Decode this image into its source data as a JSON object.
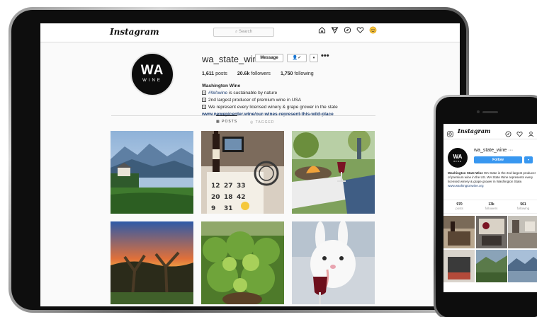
{
  "tablet": {
    "brand": "Instagram",
    "search_placeholder": "⌕ Search",
    "profile": {
      "avatar_top": "WA",
      "avatar_bottom": "WINE",
      "username": "wa_state_wine",
      "message_label": "Message",
      "follow_label": "👤✓",
      "caret_label": "▾",
      "more_label": "•••",
      "stats": [
        {
          "value": "1,611",
          "label": "posts"
        },
        {
          "value": "20.6k",
          "label": "followers"
        },
        {
          "value": "1,750",
          "label": "following"
        }
      ],
      "bio_name": "Washington Wine",
      "bio_lines": [
        "#WAwine is sustainable by nature",
        "2nd largest producer of premium wine in USA",
        "We represent every licensed winery & grape grower in the state"
      ],
      "bio_hashtag": "#WAwine",
      "bio_line1_rest": " is sustainable by nature",
      "bio_link": "www.newepicenter.wine/our-wines-represent-this-wild-place"
    },
    "tabs": [
      {
        "label": "▦ POSTS",
        "active": true
      },
      {
        "label": "◎ TAGGED",
        "active": false
      }
    ]
  },
  "phone": {
    "brand": "Instagram",
    "avatar_top": "WA",
    "avatar_bottom": "WINE",
    "username": "wa_state_wine ···",
    "follow_label": "Follow",
    "follow_caret": "▾",
    "bio_name": "Washington State Wine",
    "bio_text": " WA State is the 2nd largest producer of premium wine in the US. WA State Wine represents every licensed winery & grape grower in Washington State.",
    "bio_link": "www.washingtonwine.org",
    "stats": [
      {
        "value": "970",
        "label": "posts"
      },
      {
        "value": "13k",
        "label": "followers"
      },
      {
        "value": "561",
        "label": "following"
      }
    ]
  },
  "colors": {
    "accent_blue": "#3897f0",
    "link": "#1d3f73",
    "border": "#dbdbdb"
  },
  "icons": [
    "home-icon",
    "send-icon",
    "explore-icon",
    "heart-icon",
    "profile-icon",
    "camera-icon"
  ]
}
